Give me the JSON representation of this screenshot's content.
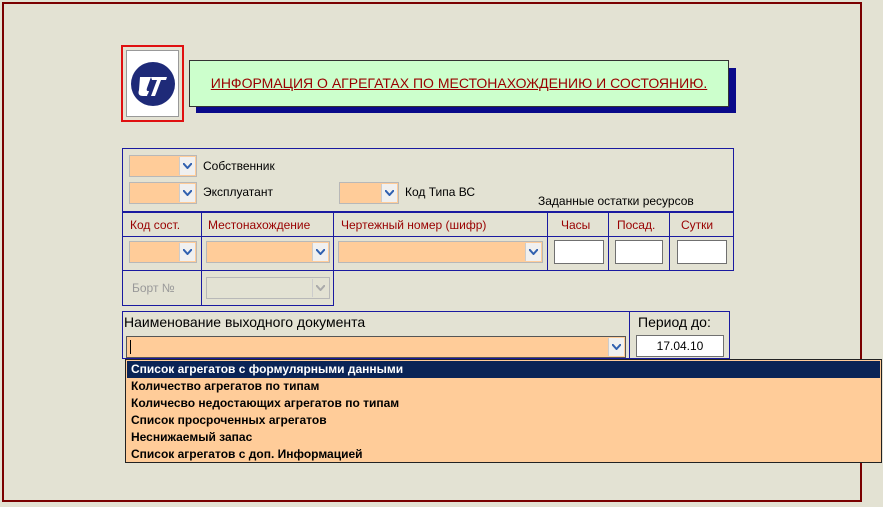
{
  "title": "ИНФОРМАЦИЯ О АГРЕГАТАХ ПО МЕСТОНАХОЖДЕНИЮ И СОСТОЯНИЮ.",
  "logo": {
    "icon": "ut-logo-icon",
    "color": "#1e2a78"
  },
  "filters": {
    "owner_label": "Собственник",
    "operator_label": "Эксплуатант",
    "aircraft_type_label": "Код Типа ВС",
    "resources_label": "Заданные остатки ресурсов"
  },
  "columns": {
    "state_code": "Код сост.",
    "location": "Местонахождение",
    "drawing_number": "Чертежный номер (шифр)",
    "hours": "Часы",
    "landings": "Посад.",
    "days": "Сутки"
  },
  "board_label": "Борт №",
  "document": {
    "label": "Наименование выходного документа",
    "period_label": "Период до:",
    "period_value": "17.04.10",
    "options": [
      "Список агрегатов с формулярными данными",
      "Количество агрегатов по типам",
      "Количесво недостающих агрегатов по типам",
      "Список просроченных агрегатов",
      "Неснижаемый запас",
      "Список агрегатов с доп. Информацией"
    ],
    "selected_index": 0
  },
  "colors": {
    "accent_red": "#990000",
    "panel_border": "#1a1aa0",
    "combo_bg": "#ffcc99",
    "title_bg": "#ccffcc",
    "selection_bg": "#0a2456"
  }
}
